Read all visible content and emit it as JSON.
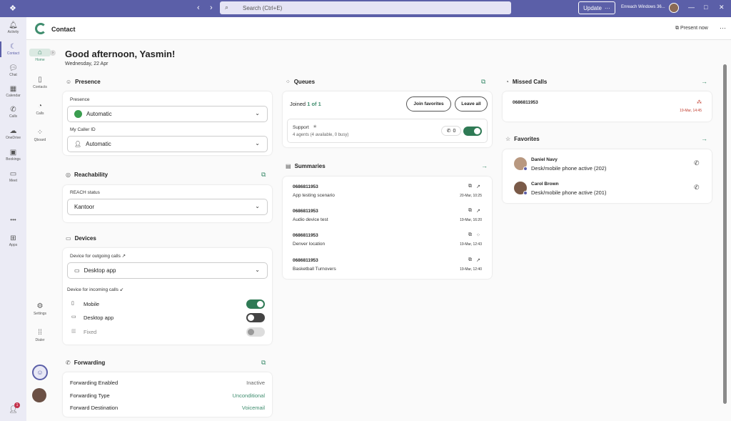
{
  "titlebar": {
    "search_placeholder": "Search (Ctrl+E)",
    "update_label": "Update",
    "org": "Enreach Windows 36..."
  },
  "rail": [
    {
      "label": "Activity",
      "icon": "bell-icon"
    },
    {
      "label": "Contact",
      "icon": "contact-app-icon"
    },
    {
      "label": "Chat",
      "icon": "chat-icon"
    },
    {
      "label": "Calendar",
      "icon": "calendar-icon"
    },
    {
      "label": "Calls",
      "icon": "phone-icon"
    },
    {
      "label": "OneDrive",
      "icon": "cloud-icon"
    },
    {
      "label": "Bookings",
      "icon": "bookings-icon"
    },
    {
      "label": "Meet",
      "icon": "video-icon"
    },
    {
      "label": "Apps",
      "icon": "add-apps-icon"
    }
  ],
  "rail_more": "•••",
  "rail_badge": "1",
  "app": {
    "title": "Contact",
    "present": "Present now"
  },
  "nav": [
    {
      "label": "Home"
    },
    {
      "label": "Contacts"
    },
    {
      "label": "Calls"
    },
    {
      "label": "Qboard"
    },
    {
      "label": "Settings"
    },
    {
      "label": "Dialer"
    }
  ],
  "greeting": "Good afternoon, Yasmin!",
  "date": "Wednesday, 22 Apr",
  "presence": {
    "title": "Presence",
    "presence_label": "Presence",
    "presence_value": "Automatic",
    "caller_label": "My Caller ID",
    "caller_value": "Automatic"
  },
  "reach": {
    "title": "Reachability",
    "status_label": "REACH status",
    "status_value": "Kantoor"
  },
  "devices": {
    "title": "Devices",
    "out_label": "Device for outgoing calls ↗",
    "out_value": "Desktop app",
    "in_label": "Device for incoming calls ↙",
    "items": [
      {
        "label": "Mobile",
        "state": "on"
      },
      {
        "label": "Desktop app",
        "state": "off"
      },
      {
        "label": "Fixed",
        "state": "disabled"
      }
    ]
  },
  "forwarding": {
    "title": "Forwarding",
    "rows": [
      {
        "label": "Forwarding Enabled",
        "value": "Inactive"
      },
      {
        "label": "Forwarding Type",
        "value": "Unconditional"
      },
      {
        "label": "Forward Destination",
        "value": "Voicemail"
      }
    ]
  },
  "queues": {
    "title": "Queues",
    "joined_prefix": "Joined ",
    "joined_count": "1 of 1",
    "join_fav": "Join favorites",
    "leave_all": "Leave all",
    "queue_name": "Support",
    "queue_sub": "4 agents (4 available, 0 busy)",
    "queue_count": "0"
  },
  "summaries": {
    "title": "Summaries",
    "items": [
      {
        "number": "0686811953",
        "desc": "App testing scenario",
        "time": "20-Mar, 10:25"
      },
      {
        "number": "0686811953",
        "desc": "Audio device test",
        "time": "19-Mar, 16:20"
      },
      {
        "number": "0686811953",
        "desc": "Denver location",
        "time": "19-Mar, 12:43"
      },
      {
        "number": "0686811953",
        "desc": "Basketball Turnovers",
        "time": "19-Mar, 12:40"
      }
    ]
  },
  "missed": {
    "title": "Missed Calls",
    "number": "0686811953",
    "time": "19-Mar, 14:45"
  },
  "favorites": {
    "title": "Favorites",
    "items": [
      {
        "name": "Daniel Navy",
        "status": "Desk/mobile phone active (202)"
      },
      {
        "name": "Carol Brown",
        "status": "Desk/mobile phone active (201)"
      }
    ]
  },
  "colors": {
    "accent": "#3f8d6e",
    "brand": "#5b5fa8",
    "missed": "#c0392b"
  }
}
